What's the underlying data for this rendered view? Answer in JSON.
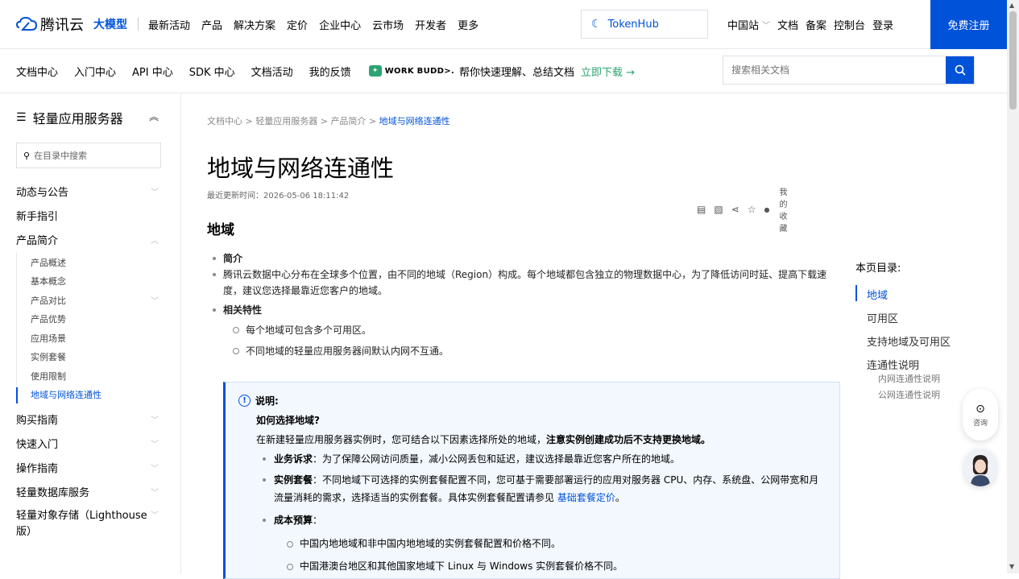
{
  "header": {
    "logo_text": "腾讯云",
    "llm_label": "大模型",
    "menu": [
      "最新活动",
      "产品",
      "解决方案",
      "定价",
      "企业中心",
      "云市场",
      "开发者",
      "更多"
    ],
    "tokenhub_label": "TokenHub",
    "right_menu": {
      "region": "中国站",
      "docs": "文档",
      "beian": "备案",
      "console": "控制台",
      "login": "登录"
    },
    "signup_label": "免费注册"
  },
  "subnav": {
    "items": [
      "文档中心",
      "入门中心",
      "API 中心",
      "SDK 中心",
      "文档活动",
      "我的反馈"
    ],
    "workbuddy_name": "WORK BUDD>.",
    "workbuddy_text": "帮你快速理解、总结文档",
    "workbuddy_download": "立即下载 →",
    "search_placeholder": "搜索相关文档"
  },
  "sidebar": {
    "title": "轻量应用服务器",
    "search_placeholder": "在目录中搜索",
    "items": [
      {
        "label": "动态与公告"
      },
      {
        "label": "新手指引"
      },
      {
        "label": "产品简介"
      }
    ],
    "sub_items": [
      "产品概述",
      "基本概念",
      "产品对比",
      "产品优势",
      "应用场景",
      "实例套餐",
      "使用限制",
      "地域与网络连通性"
    ],
    "items_after": [
      "购买指南",
      "快速入门",
      "操作指南",
      "轻量数据库服务",
      "轻量对象存储（Lighthouse版）"
    ]
  },
  "breadcrumb": {
    "items": [
      "文档中心",
      "轻量应用服务器",
      "产品简介"
    ],
    "current": "地域与网络连通性",
    "sep": ">"
  },
  "page": {
    "title": "地域与网络连通性",
    "updated": "最近更新时间：2026-05-06 18:11:42",
    "favorite_label": "我的收藏",
    "section_title": "地域",
    "intro_title": "简介",
    "intro_text": "腾讯云数据中心分布在全球多个位置，由不同的地域（Region）构成。每个地域都包含独立的物理数据中心，为了降低访问时延、提高下载速度，建议您选择最靠近您客户的地域。",
    "features_title": "相关特性",
    "features": [
      "每个地域可包含多个可用区。",
      "不同地域的轻量应用服务器间默认内网不互通。"
    ]
  },
  "note": {
    "label": "说明:",
    "question": "如何选择地域?",
    "lead": "在新建轻量应用服务器实例时，您可结合以下因素选择所处的地域，",
    "lead_bold": "注意实例创建成功后不支持更换地域。",
    "p1_bold": "业务诉求",
    "p1_text": "：为了保障公网访问质量，减小公网丢包和延迟，建议选择最靠近您客户所在的地域。",
    "p2_bold": "实例套餐",
    "p2_text": "：不同地域下可选择的实例套餐配置不同，您可基于需要部署运行的应用对服务器 CPU、内存、系统盘、公网带宽和月流量消耗的需求，选择适当的实例套餐。具体实例套餐配置请参见 ",
    "p2_link": "基础套餐定价",
    "p2_end": "。",
    "p3_bold": "成本预算",
    "p3_text": "：",
    "sub1": "中国内地地域和非中国内地地域的实例套餐配置和价格不同。",
    "sub2": "中国港澳台地区和其他国家地域下 Linux 与 Windows 实例套餐价格不同。"
  },
  "toc": {
    "title": "本页目录:",
    "items": [
      "地域",
      "可用区",
      "支持地域及可用区",
      "连通性说明"
    ],
    "sub_items": [
      "内网连通性说明",
      "公网连通性说明"
    ]
  },
  "float": {
    "consult_label": "咨询"
  },
  "colors": {
    "primary": "#0052d9",
    "green": "#2ba471"
  }
}
